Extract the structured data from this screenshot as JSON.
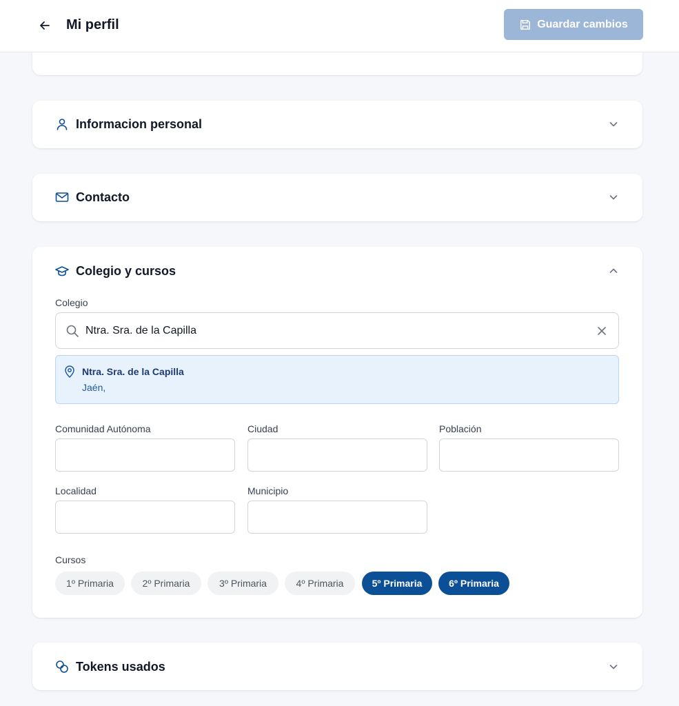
{
  "header": {
    "title": "Mi perfil",
    "save_label": "Guardar cambios"
  },
  "sections": {
    "personal": {
      "title": "Informacion personal",
      "icon": "user-icon",
      "expanded": false
    },
    "contact": {
      "title": "Contacto",
      "icon": "mail-icon",
      "expanded": false
    },
    "school": {
      "title": "Colegio y cursos",
      "icon": "graduation-cap-icon",
      "expanded": true,
      "school_label": "Colegio",
      "search_value": "Ntra. Sra. de la Capilla",
      "result": {
        "name": "Ntra. Sra. de la Capilla",
        "city": "Jaén,"
      },
      "fields": {
        "comunidad": {
          "label": "Comunidad Autónoma",
          "value": ""
        },
        "ciudad": {
          "label": "Ciudad",
          "value": ""
        },
        "poblacion": {
          "label": "Población",
          "value": ""
        },
        "localidad": {
          "label": "Localidad",
          "value": ""
        },
        "municipio": {
          "label": "Municipio",
          "value": ""
        }
      },
      "courses_label": "Cursos",
      "courses": [
        {
          "label": "1º Primaria",
          "selected": false
        },
        {
          "label": "2º Primaria",
          "selected": false
        },
        {
          "label": "3º Primaria",
          "selected": false
        },
        {
          "label": "4º Primaria",
          "selected": false
        },
        {
          "label": "5º Primaria",
          "selected": true
        },
        {
          "label": "6º Primaria",
          "selected": true
        }
      ]
    },
    "tokens": {
      "title": "Tokens usados",
      "icon": "coins-icon",
      "expanded": false
    }
  },
  "colors": {
    "accent": "#0b4f96",
    "save_button_disabled": "#9cb6d8",
    "icon_blue": "#0b4f96",
    "result_bg": "#e8f2fd"
  }
}
